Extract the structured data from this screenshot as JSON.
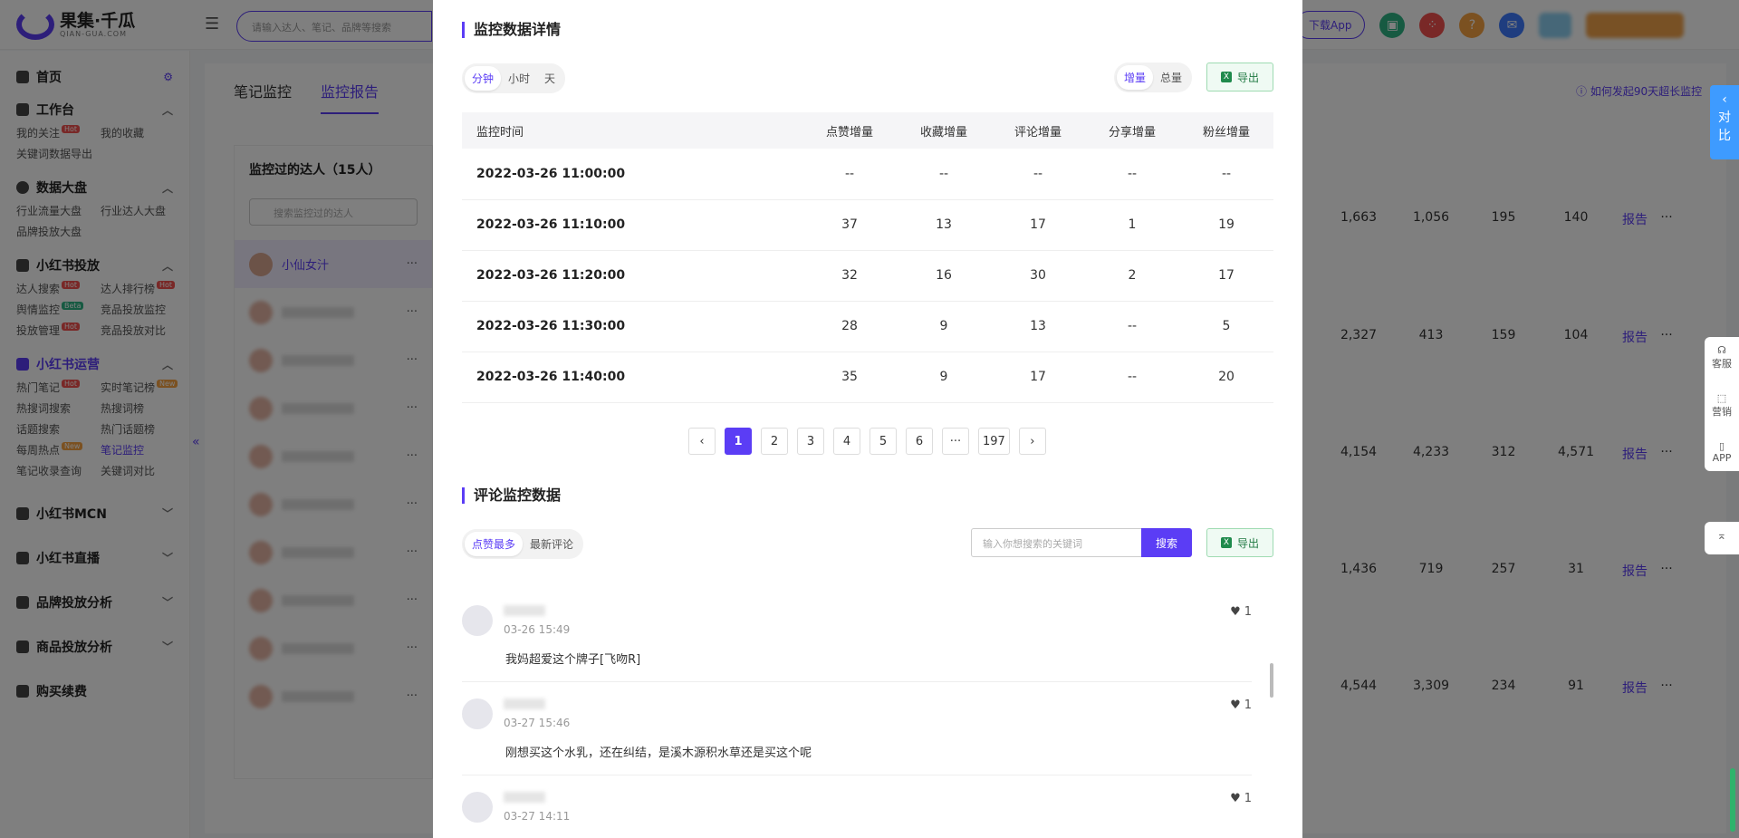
{
  "header": {
    "logo_title": "果集·千瓜",
    "logo_sub": "QIAN-GUA.COM",
    "search_placeholder": "请输入达人、笔记、品牌等搜索",
    "download_app": "下载App"
  },
  "sidebar": {
    "home": "首页",
    "sections": [
      {
        "title": "工作台",
        "items": [
          {
            "label": "我的关注",
            "tag": "Hot"
          },
          {
            "label": "我的收藏"
          },
          {
            "label": "关键词数据导出"
          }
        ]
      },
      {
        "title": "数据大盘",
        "items": [
          {
            "label": "行业流量大盘"
          },
          {
            "label": "行业达人大盘"
          },
          {
            "label": "品牌投放大盘"
          }
        ]
      },
      {
        "title": "小红书投放",
        "items": [
          {
            "label": "达人搜索",
            "tag": "Hot"
          },
          {
            "label": "达人排行榜",
            "tag": "Hot"
          },
          {
            "label": "舆情监控",
            "tag": "Beta"
          },
          {
            "label": "竞品投放监控"
          },
          {
            "label": "投放管理",
            "tag": "Hot"
          },
          {
            "label": "竞品投放对比"
          }
        ]
      },
      {
        "title": "小红书运营",
        "items": [
          {
            "label": "热门笔记",
            "tag": "Hot"
          },
          {
            "label": "实时笔记榜",
            "tag": "New"
          },
          {
            "label": "热搜词搜索"
          },
          {
            "label": "热搜词榜"
          },
          {
            "label": "话题搜索"
          },
          {
            "label": "热门话题榜"
          },
          {
            "label": "每周热点",
            "tag": "New"
          },
          {
            "label": "笔记监控"
          },
          {
            "label": "笔记收录查询"
          },
          {
            "label": "关键词对比"
          }
        ]
      }
    ],
    "collapsed": [
      "小红书MCN",
      "小红书直播",
      "品牌投放分析",
      "商品投放分析",
      "购买续费"
    ]
  },
  "page": {
    "tabs": [
      "笔记监控",
      "监控报告"
    ],
    "how_link": "如何发起90天超长监控",
    "kol_title": "监控过的达人（15人）",
    "kol_search_placeholder": "搜索监控过的达人",
    "kol_selected": "小仙女汁",
    "bg_rows": [
      [
        "1,663",
        "1,056",
        "195",
        "140",
        "报告"
      ],
      [
        "2,327",
        "413",
        "159",
        "104",
        "报告"
      ],
      [
        "4,154",
        "4,233",
        "312",
        "4,571",
        "报告"
      ],
      [
        "1,436",
        "719",
        "257",
        "31",
        "报告"
      ],
      [
        "4,544",
        "3,309",
        "234",
        "91",
        "报告"
      ]
    ]
  },
  "float": {
    "compare": "对比",
    "tools": [
      "客服",
      "营销",
      "APP"
    ]
  },
  "modal": {
    "section1_title": "监控数据详情",
    "time_seg": [
      "分钟",
      "小时",
      "天"
    ],
    "mode_seg": [
      "增量",
      "总量"
    ],
    "export": "导出",
    "columns": [
      "监控时间",
      "点赞增量",
      "收藏增量",
      "评论增量",
      "分享增量",
      "粉丝增量"
    ],
    "rows": [
      [
        "2022-03-26 11:00:00",
        "--",
        "--",
        "--",
        "--",
        "--"
      ],
      [
        "2022-03-26 11:10:00",
        "37",
        "13",
        "17",
        "1",
        "19"
      ],
      [
        "2022-03-26 11:20:00",
        "32",
        "16",
        "30",
        "2",
        "17"
      ],
      [
        "2022-03-26 11:30:00",
        "28",
        "9",
        "13",
        "--",
        "5"
      ],
      [
        "2022-03-26 11:40:00",
        "35",
        "9",
        "17",
        "--",
        "20"
      ]
    ],
    "pages": [
      "1",
      "2",
      "3",
      "4",
      "5",
      "6",
      "···",
      "197"
    ],
    "section2_title": "评论监控数据",
    "comment_seg": [
      "点赞最多",
      "最新评论"
    ],
    "comment_search_placeholder": "输入你想搜索的关键词",
    "search_btn": "搜索",
    "comments": [
      {
        "time": "03-26 15:49",
        "text": "我妈超爱这个牌子[飞吻R]",
        "likes": "1"
      },
      {
        "time": "03-27 15:46",
        "text": "刚想买这个水乳，还在纠结，是溪木源积水草还是买这个呢",
        "likes": "1"
      },
      {
        "time": "03-27 14:11",
        "text": "",
        "likes": "1"
      }
    ]
  }
}
